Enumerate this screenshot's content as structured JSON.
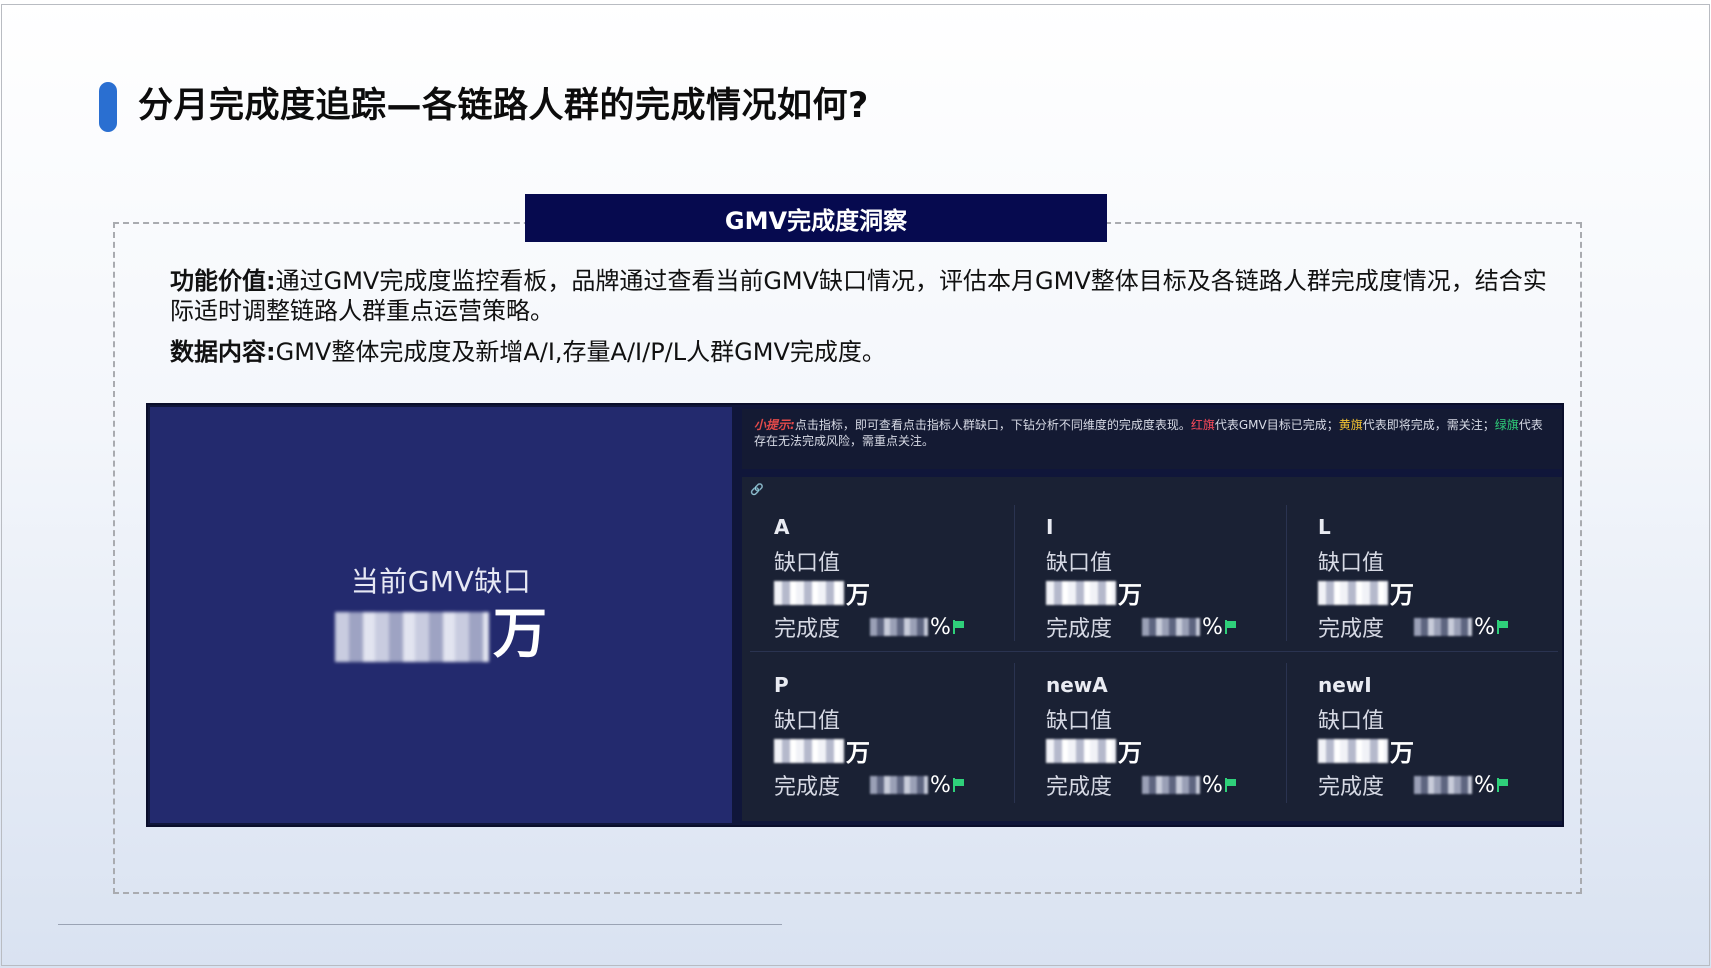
{
  "title": "分月完成度追踪—各链路人群的完成情况如何?",
  "section": {
    "tab": "GMV完成度洞察"
  },
  "description": {
    "value_label": "功能价值:",
    "value_text": "通过GMV完成度监控看板，品牌通过查看当前GMV缺口情况，评估本月GMV整体目标及各链路人群完成度情况，结合实际适时调整链路人群重点运营策略。",
    "content_label": "数据内容:",
    "content_text": "GMV整体完成度及新增A/I,存量A/I/P/L人群GMV完成度。"
  },
  "dashboard": {
    "gap_label": "当前GMV缺口",
    "gap_unit": "万",
    "tip": {
      "label": "小提示:",
      "part1": "点击指标，即可查看点击指标人群缺口，下钻分析不同维度的完成度表现。",
      "red": "红旗",
      "part2": "代表GMV目标已完成；",
      "yellow": "黄旗",
      "part3": "代表即将完成，需关注；",
      "green": "绿旗",
      "part4": "代表存在无法完成风险，需重点关注。"
    },
    "cells": [
      {
        "name": "A",
        "gap_label": "缺口值",
        "unit": "万",
        "rate_label": "完成度",
        "pct": "%"
      },
      {
        "name": "I",
        "gap_label": "缺口值",
        "unit": "万",
        "rate_label": "完成度",
        "pct": "%"
      },
      {
        "name": "L",
        "gap_label": "缺口值",
        "unit": "万",
        "rate_label": "完成度",
        "pct": "%"
      },
      {
        "name": "P",
        "gap_label": "缺口值",
        "unit": "万",
        "rate_label": "完成度",
        "pct": "%"
      },
      {
        "name": "newA",
        "gap_label": "缺口值",
        "unit": "万",
        "rate_label": "完成度",
        "pct": "%"
      },
      {
        "name": "newI",
        "gap_label": "缺口值",
        "unit": "万",
        "rate_label": "完成度",
        "pct": "%"
      }
    ]
  },
  "colors": {
    "accent": "#2a6fd1",
    "tab_bg": "#060a4f",
    "panel_left": "#232a6e",
    "panel_right": "#1a2134",
    "flag_green": "#2fd07a"
  }
}
